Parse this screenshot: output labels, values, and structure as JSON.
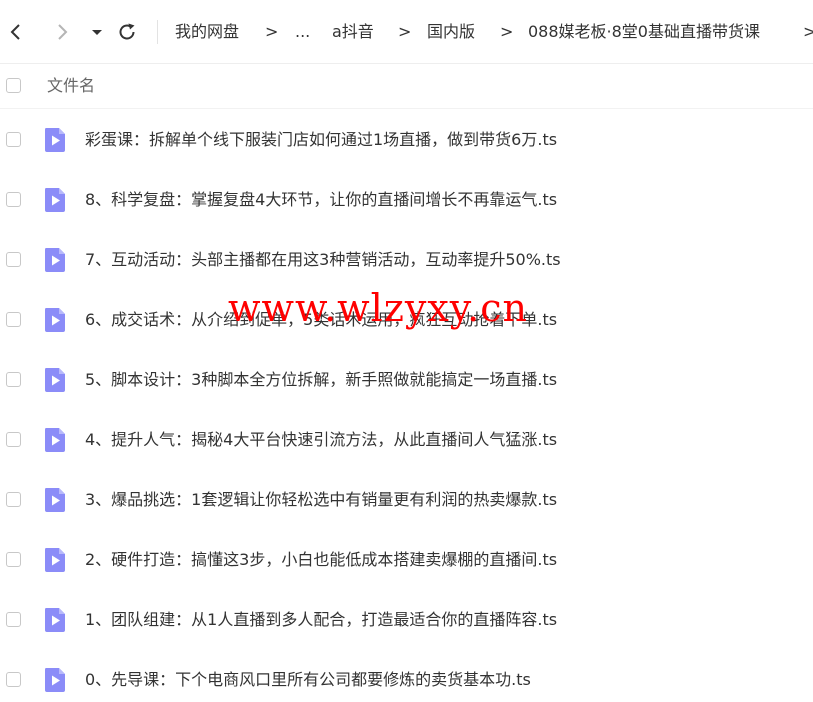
{
  "toolbar": {
    "back_icon": "chevron-left-icon",
    "forward_icon": "chevron-right-icon",
    "history_icon": "caret-down-icon",
    "refresh_icon": "refresh-icon",
    "breadcrumb": [
      "我的网盘",
      "...",
      "a抖音",
      "国内版",
      "088媒老板·8堂0基础直播带货课"
    ],
    "separator": ">"
  },
  "header": {
    "column_label": "文件名"
  },
  "files": [
    {
      "name": "彩蛋课：拆解单个线下服装门店如何通过1场直播，做到带货6万.ts",
      "icon": "video-file-icon"
    },
    {
      "name": "8、科学复盘：掌握复盘4大环节，让你的直播间增长不再靠运气.ts",
      "icon": "video-file-icon"
    },
    {
      "name": "7、互动活动：头部主播都在用这3种营销活动，互动率提升50%.ts",
      "icon": "video-file-icon"
    },
    {
      "name": "6、成交话术：从介绍到促单，5类话术运用，疯狂互动抢着下单.ts",
      "icon": "video-file-icon"
    },
    {
      "name": "5、脚本设计：3种脚本全方位拆解，新手照做就能搞定一场直播.ts",
      "icon": "video-file-icon"
    },
    {
      "name": "4、提升人气：揭秘4大平台快速引流方法，从此直播间人气猛涨.ts",
      "icon": "video-file-icon"
    },
    {
      "name": "3、爆品挑选：1套逻辑让你轻松选中有销量更有利润的热卖爆款.ts",
      "icon": "video-file-icon"
    },
    {
      "name": "2、硬件打造：搞懂这3步，小白也能低成本搭建卖爆棚的直播间.ts",
      "icon": "video-file-icon"
    },
    {
      "name": "1、团队组建：从1人直播到多人配合，打造最适合你的直播阵容.ts",
      "icon": "video-file-icon"
    },
    {
      "name": "0、先导课：下个电商风口里所有公司都要修炼的卖货基本功.ts",
      "icon": "video-file-icon"
    }
  ],
  "watermark": "www.wlzyxy.cn",
  "colors": {
    "file_icon": "#8b8cf8",
    "watermark": "#ff0000",
    "text": "#333333"
  }
}
